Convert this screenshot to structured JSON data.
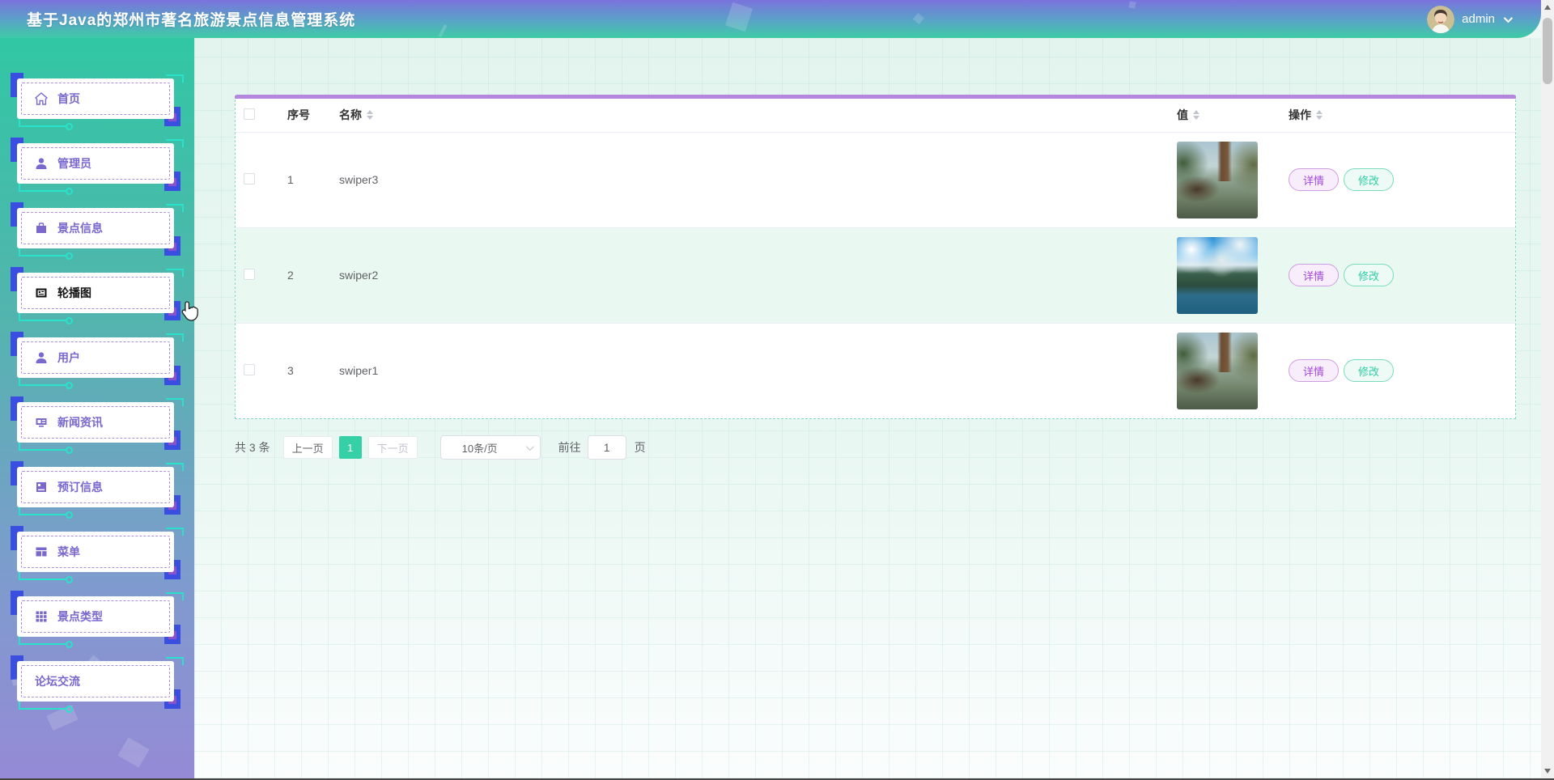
{
  "header": {
    "title": "基于Java的郑州市著名旅游景点信息管理系统",
    "user_name": "admin"
  },
  "sidebar": {
    "items": [
      {
        "label": "首页",
        "icon": "home-icon",
        "active": false
      },
      {
        "label": "管理员",
        "icon": "admin-user-icon",
        "active": false
      },
      {
        "label": "景点信息",
        "icon": "briefcase-icon",
        "active": false
      },
      {
        "label": "轮播图",
        "icon": "carousel-image-icon",
        "active": true
      },
      {
        "label": "用户",
        "icon": "user-icon",
        "active": false
      },
      {
        "label": "新闻资讯",
        "icon": "news-icon",
        "active": false
      },
      {
        "label": "预订信息",
        "icon": "booking-icon",
        "active": false
      },
      {
        "label": "菜单",
        "icon": "menu-table-icon",
        "active": false
      },
      {
        "label": "景点类型",
        "icon": "grid-icon",
        "active": false
      },
      {
        "label": "论坛交流",
        "icon": "",
        "active": false
      }
    ]
  },
  "table": {
    "headers": {
      "index": "序号",
      "name": "名称",
      "value": "值",
      "actions": "操作"
    },
    "rows": [
      {
        "index": "1",
        "name": "swiper3",
        "image": "karst-cliffs-scenic-photo"
      },
      {
        "index": "2",
        "name": "swiper2",
        "image": "mountain-lake-scenic-photo"
      },
      {
        "index": "3",
        "name": "swiper1",
        "image": "karst-cliffs-scenic-photo"
      }
    ],
    "actions": {
      "detail": "详情",
      "edit": "修改"
    }
  },
  "pagination": {
    "total_text": "共 3 条",
    "prev_label": "上一页",
    "current_page": "1",
    "next_label": "下一页",
    "page_size": "10条/页",
    "goto_label": "前往",
    "goto_value": "1",
    "page_suffix": "页"
  },
  "colors": {
    "header_gradient_top": "#7b72dd",
    "header_gradient_bottom": "#3fcba7",
    "sidebar_top": "#31c7a4",
    "sidebar_bottom": "#958ad6",
    "table_topbar": "#b287dc",
    "table_dashed_border": "#82d9c6",
    "striped_row_bg": "#e9f8f1",
    "detail_button": "#a249d6",
    "edit_button": "#2fcfa2",
    "active_page_bg": "#35d0a6"
  }
}
